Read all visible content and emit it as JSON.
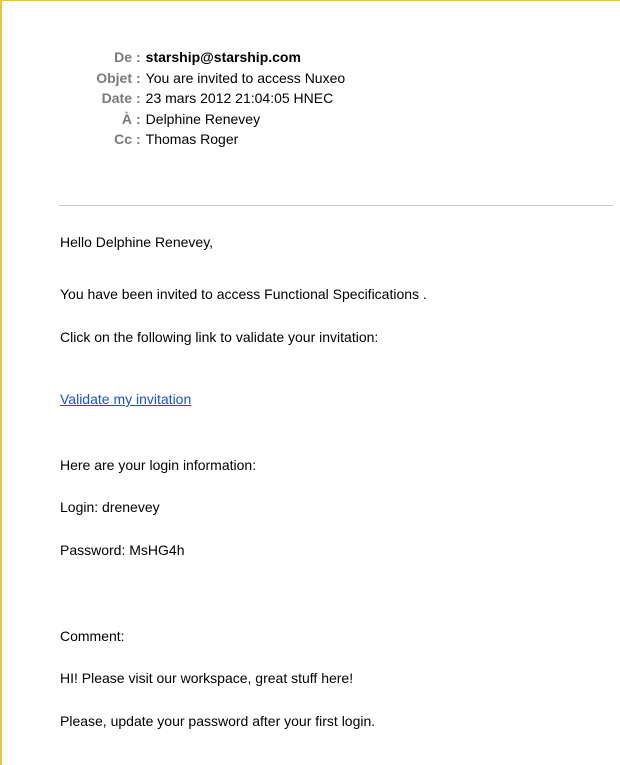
{
  "header": {
    "from_label": "De",
    "from_value": "starship@starship.com",
    "subject_label": "Objet",
    "subject_value": "You are invited to access Nuxeo",
    "date_label": "Date",
    "date_value": "23 mars 2012 21:04:05 HNEC",
    "to_label": "À",
    "to_value": "Delphine Renevey",
    "cc_label": "Cc",
    "cc_value": "Thomas Roger"
  },
  "message": {
    "greeting": "Hello Delphine Renevey,",
    "invited": "You have been invited to access Functional Specifications .",
    "click_instruction": "Click on the following link to validate your invitation:",
    "validate_link": "Validate my invitation",
    "login_intro": "Here are your login information:",
    "login": "Login: drenevey",
    "password": "Password: MsHG4h",
    "comment_label": "Comment:",
    "comment_text": "HI! Please visit our workspace, great stuff here!",
    "update_notice": "Please, update your password after your first login."
  },
  "colors": {
    "frame_border": "#e8c54a",
    "label_gray": "#7a7a7a",
    "link_blue": "#1a4fd6"
  }
}
